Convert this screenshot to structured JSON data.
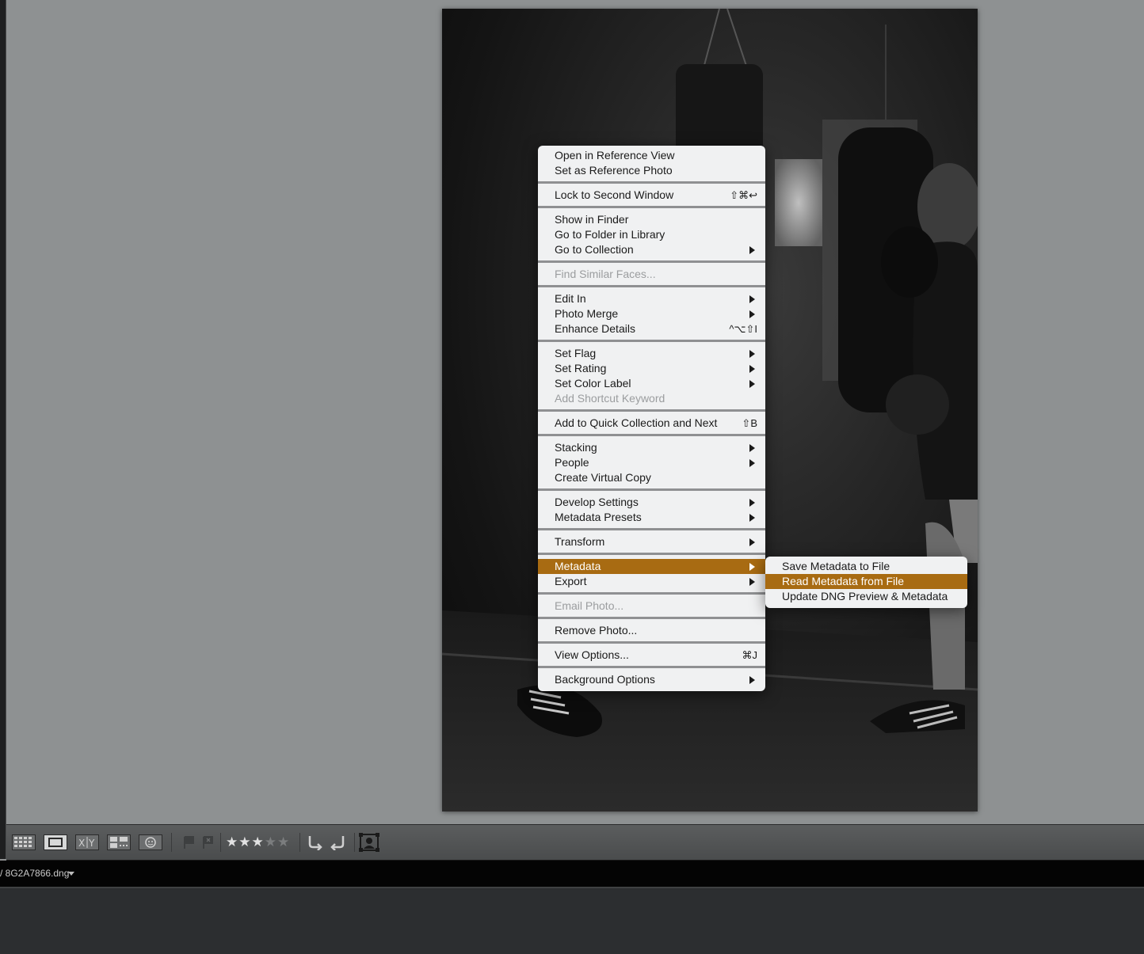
{
  "context_menu": {
    "items": [
      {
        "label": "Open in Reference View"
      },
      {
        "label": "Set as Reference Photo"
      },
      {
        "label": "Lock to Second Window",
        "shortcut": "⇧⌘↩"
      },
      {
        "label": "Show in Finder"
      },
      {
        "label": "Go to Folder in Library"
      },
      {
        "label": "Go to Collection"
      },
      {
        "label": "Find Similar Faces..."
      },
      {
        "label": "Edit In"
      },
      {
        "label": "Photo Merge"
      },
      {
        "label": "Enhance Details",
        "shortcut": "^⌥⇧I"
      },
      {
        "label": "Set Flag"
      },
      {
        "label": "Set Rating"
      },
      {
        "label": "Set Color Label"
      },
      {
        "label": "Add Shortcut Keyword"
      },
      {
        "label": "Add to Quick Collection and Next",
        "shortcut": "⇧B"
      },
      {
        "label": "Stacking"
      },
      {
        "label": "People"
      },
      {
        "label": "Create Virtual Copy"
      },
      {
        "label": "Develop Settings"
      },
      {
        "label": "Metadata Presets"
      },
      {
        "label": "Transform"
      },
      {
        "label": "Metadata"
      },
      {
        "label": "Export"
      },
      {
        "label": "Email Photo..."
      },
      {
        "label": "Remove Photo..."
      },
      {
        "label": "View Options...",
        "shortcut": "⌘J"
      },
      {
        "label": "Background Options"
      }
    ]
  },
  "metadata_submenu": {
    "items": [
      {
        "label": "Save Metadata to File"
      },
      {
        "label": "Read Metadata from File"
      },
      {
        "label": "Update DNG Preview & Metadata"
      }
    ]
  },
  "toolbar": {
    "survey_label": "X|Y",
    "rating": 3,
    "rating_max": 5,
    "stars": "★★★★★"
  },
  "filmstrip": {
    "filename": "/ 8G2A7866.dng"
  },
  "colors": {
    "highlight": "#a86b12",
    "menu_bg": "#f0f1f2",
    "background": "#8e9192"
  }
}
